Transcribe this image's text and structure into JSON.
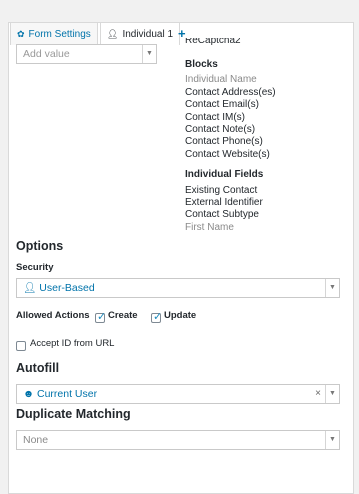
{
  "tabs": {
    "settings_label": "Form Settings",
    "individual_label": "Individual 1",
    "add_label": "+"
  },
  "add_value": {
    "placeholder": "Add value"
  },
  "blocks": {
    "partial_top": "ReCaptcha2",
    "heading": "Blocks",
    "items": [
      "Individual Name",
      "Contact Address(es)",
      "Contact Email(s)",
      "Contact IM(s)",
      "Contact Note(s)",
      "Contact Phone(s)",
      "Contact Website(s)"
    ],
    "fields_heading": "Individual Fields",
    "fields": [
      "Existing Contact",
      "External Identifier",
      "Contact Subtype",
      "First Name"
    ]
  },
  "options": {
    "heading": "Options",
    "security_label": "Security",
    "security_value": "User-Based",
    "allowed_actions_label": "Allowed Actions",
    "create_label": "Create",
    "create_checked": true,
    "update_label": "Update",
    "update_checked": true,
    "accept_id_label": "Accept ID from URL",
    "accept_id_checked": false
  },
  "autofill": {
    "heading": "Autofill",
    "value": "Current User",
    "clear": "×"
  },
  "duplicate": {
    "heading": "Duplicate Matching",
    "value": "None"
  }
}
